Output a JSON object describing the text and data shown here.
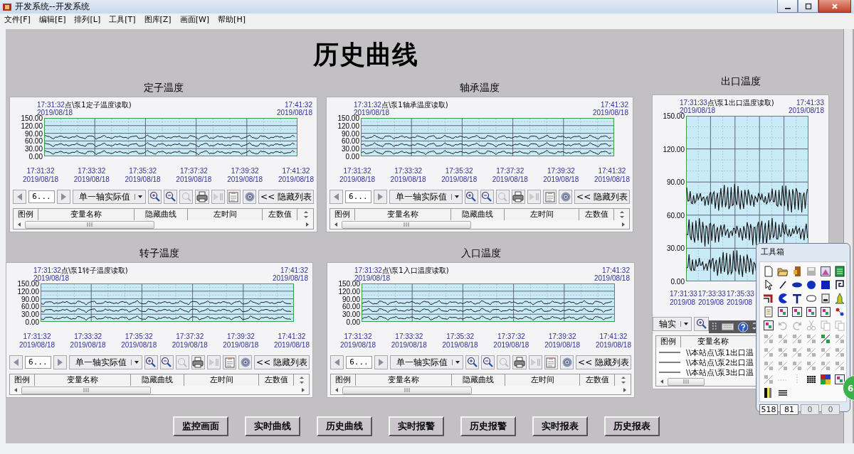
{
  "window": {
    "title": "开发系统--开发系统"
  },
  "menu": [
    "文件[F]",
    "编辑[E]",
    "排列[L]",
    "工具[T]",
    "图库[Z]",
    "画面[W]",
    "帮助[H]"
  ],
  "screen_title": "历史曲线",
  "trends": [
    {
      "kind": "wide",
      "title": "定子温度",
      "start_time": "17:31:32",
      "caption": "点\\泵1定子温度读取)",
      "start_date": "2019/08/18",
      "end_time": "17:41:32",
      "end_date": "2019/08/18",
      "y_ticks": [
        "150.00",
        "120.00",
        "90.00",
        "60.00",
        "30.00",
        "0.00"
      ],
      "x_ticks": [
        {
          "time": "17:31:32",
          "date": "2019/08/18"
        },
        {
          "time": "17:33:32",
          "date": "2019/08/18"
        },
        {
          "time": "17:35:32",
          "date": "2019/08/18"
        },
        {
          "time": "17:37:32",
          "date": "2019/08/18"
        },
        {
          "time": "17:39:32",
          "date": "2019/08/18"
        },
        {
          "time": "17:41:32",
          "date": "2019/08/18"
        }
      ],
      "page": "6...",
      "axis_mode": "单一轴实际值",
      "hide_list": "<< 隐藏列表",
      "columns": [
        "图例",
        "变量名称",
        "隐藏曲线",
        "左时间",
        "左数值"
      ]
    },
    {
      "kind": "wide",
      "title": "轴承温度",
      "start_time": "17:31:32",
      "caption": "点\\泵1轴承温度读取)",
      "start_date": "2019/08/18",
      "end_time": "17:41:32",
      "end_date": "2019/08/18",
      "y_ticks": [
        "150.00",
        "120.00",
        "90.00",
        "60.00",
        "30.00",
        "0.00"
      ],
      "x_ticks": [
        {
          "time": "17:31:32",
          "date": "2019/08/18"
        },
        {
          "time": "17:33:32",
          "date": "2019/08/18"
        },
        {
          "time": "17:35:32",
          "date": "2019/08/18"
        },
        {
          "time": "17:37:32",
          "date": "2019/08/18"
        },
        {
          "time": "17:39:32",
          "date": "2019/08/18"
        },
        {
          "time": "17:41:32",
          "date": "2019/08/18"
        }
      ],
      "page": "6...",
      "axis_mode": "单一轴实际值",
      "hide_list": "<< 隐藏列表",
      "columns": [
        "图例",
        "变量名称",
        "隐藏曲线",
        "左时间",
        "左数值"
      ]
    },
    {
      "kind": "wide",
      "title": "转子温度",
      "start_time": "17:31:32",
      "caption": "点\\泵1转子温度读取)",
      "start_date": "2019/08/18",
      "end_time": "17:41:32",
      "end_date": "2019/08/18",
      "y_ticks": [
        "150.00",
        "120.00",
        "90.00",
        "60.00",
        "30.00",
        "0.00"
      ],
      "x_ticks": [
        {
          "time": "17:31:32",
          "date": "2019/08/18"
        },
        {
          "time": "17:33:32",
          "date": "2019/08/18"
        },
        {
          "time": "17:35:32",
          "date": "2019/08/18"
        },
        {
          "time": "17:37:32",
          "date": "2019/08/18"
        },
        {
          "time": "17:39:32",
          "date": "2019/08/18"
        },
        {
          "time": "17:41:32",
          "date": "2019/08/18"
        }
      ],
      "page": "6...",
      "axis_mode": "单一轴实际值",
      "hide_list": "<< 隐藏列表",
      "columns": [
        "图例",
        "变量名称",
        "隐藏曲线",
        "左时间",
        "左数值"
      ]
    },
    {
      "kind": "wide",
      "title": "入口温度",
      "start_time": "17:31:32",
      "caption": "点\\泵1入口温度读取)",
      "start_date": "2019/08/18",
      "end_time": "17:41:32",
      "end_date": "2019/08/18",
      "y_ticks": [
        "150.00",
        "120.00",
        "90.00",
        "60.00",
        "30.00",
        "0.00"
      ],
      "x_ticks": [
        {
          "time": "17:31:32",
          "date": "2019/08/18"
        },
        {
          "time": "17:33:32",
          "date": "2019/08/18"
        },
        {
          "time": "17:35:32",
          "date": "2019/08/18"
        },
        {
          "time": "17:37:32",
          "date": "2019/08/18"
        },
        {
          "time": "17:39:32",
          "date": "2019/08/18"
        },
        {
          "time": "17:41:32",
          "date": "2019/08/18"
        }
      ],
      "page": "6...",
      "axis_mode": "单一轴实际值",
      "hide_list": "<< 隐藏列表",
      "columns": [
        "图例",
        "变量名称",
        "隐藏曲线",
        "左时间",
        "左数值"
      ]
    },
    {
      "kind": "tall",
      "title": "出口温度",
      "start_time": "17:31:33",
      "caption": "点\\泵1出口温度读取)",
      "start_date": "2019/08/18",
      "end_time": "17:41:33",
      "end_date": "2019/08/18",
      "y_ticks": [
        "150.00",
        "120.00",
        "90.00",
        "60.00",
        "30.00",
        "0.00"
      ],
      "x_ticks": [
        {
          "time": "17:31:33",
          "date": "2019/08"
        },
        {
          "time": "17:33:33",
          "date": "2019/08"
        },
        {
          "time": "17:35:33",
          "date": "2019/08"
        }
      ],
      "axis_mode": "轴实",
      "columns": [
        "图例",
        "变量名称"
      ],
      "rows": [
        {
          "name": "\\\\本站点\\泵1出口温"
        },
        {
          "name": "\\\\本站点\\泵2出口温"
        },
        {
          "name": "\\\\本站点\\泵3出口温"
        }
      ]
    }
  ],
  "buttons": [
    "监控画面",
    "实时曲线",
    "历史曲线",
    "实时报警",
    "历史报警",
    "实时报表",
    "历史报表"
  ],
  "toolbox": {
    "title": "工具箱",
    "tools": [
      {
        "kind": "page",
        "disabled": false
      },
      {
        "kind": "folder",
        "disabled": false
      },
      {
        "kind": "door",
        "disabled": false
      },
      {
        "kind": "floppy",
        "disabled": true
      },
      {
        "kind": "picture",
        "disabled": false
      },
      {
        "kind": "panel",
        "disabled": false
      },
      {
        "kind": "cursor",
        "disabled": false
      },
      {
        "kind": "line",
        "disabled": false
      },
      {
        "kind": "ellipse",
        "disabled": false
      },
      {
        "kind": "circle",
        "disabled": false
      },
      {
        "kind": "square",
        "disabled": false
      },
      {
        "kind": "hook",
        "disabled": false
      },
      {
        "kind": "pipe",
        "disabled": false
      },
      {
        "kind": "pie",
        "disabled": false
      },
      {
        "kind": "tee",
        "disabled": false
      },
      {
        "kind": "roundrect",
        "disabled": false
      },
      {
        "kind": "printer",
        "disabled": false
      },
      {
        "kind": "figure",
        "disabled": false
      },
      {
        "kind": "doc",
        "disabled": false
      },
      {
        "kind": "tile",
        "disabled": false
      },
      {
        "kind": "tile",
        "disabled": false
      },
      {
        "kind": "tile",
        "disabled": false
      },
      {
        "kind": "tile",
        "disabled": false
      },
      {
        "kind": "link",
        "disabled": false
      },
      {
        "kind": "tile",
        "disabled": false
      },
      {
        "kind": "undo",
        "disabled": true
      },
      {
        "kind": "redo",
        "disabled": true
      },
      {
        "kind": "scissors",
        "disabled": true
      },
      {
        "kind": "copy",
        "disabled": true
      },
      {
        "kind": "copy",
        "disabled": true
      },
      {
        "kind": "align",
        "disabled": true
      },
      {
        "kind": "align",
        "disabled": true
      },
      {
        "kind": "align",
        "disabled": true
      },
      {
        "kind": "align",
        "disabled": true
      },
      {
        "kind": "align",
        "disabled": false
      },
      {
        "kind": "align",
        "disabled": true
      },
      {
        "kind": "align",
        "disabled": true
      },
      {
        "kind": "align",
        "disabled": true
      },
      {
        "kind": "align",
        "disabled": true
      },
      {
        "kind": "align",
        "disabled": true
      },
      {
        "kind": "align",
        "disabled": true
      },
      {
        "kind": "align",
        "disabled": true
      },
      {
        "kind": "align",
        "disabled": true
      },
      {
        "kind": "align",
        "disabled": true
      },
      {
        "kind": "align",
        "disabled": true
      },
      {
        "kind": "align",
        "disabled": true
      },
      {
        "kind": "align",
        "disabled": true
      },
      {
        "kind": "align",
        "disabled": true
      },
      {
        "kind": "align",
        "disabled": true
      },
      {
        "kind": "dots",
        "disabled": true
      },
      {
        "kind": "vdots",
        "disabled": true
      },
      {
        "kind": "grid",
        "disabled": false
      },
      {
        "kind": "palette",
        "disabled": false
      },
      {
        "kind": "tile",
        "disabled": false
      },
      {
        "kind": "bars",
        "disabled": false
      },
      {
        "kind": "lines",
        "disabled": false
      }
    ],
    "fields": [
      {
        "value": "518",
        "disabled": false
      },
      {
        "value": "81",
        "disabled": false
      },
      {
        "value": "0",
        "disabled": true
      },
      {
        "value": "0",
        "disabled": true
      }
    ]
  },
  "badge": "6"
}
